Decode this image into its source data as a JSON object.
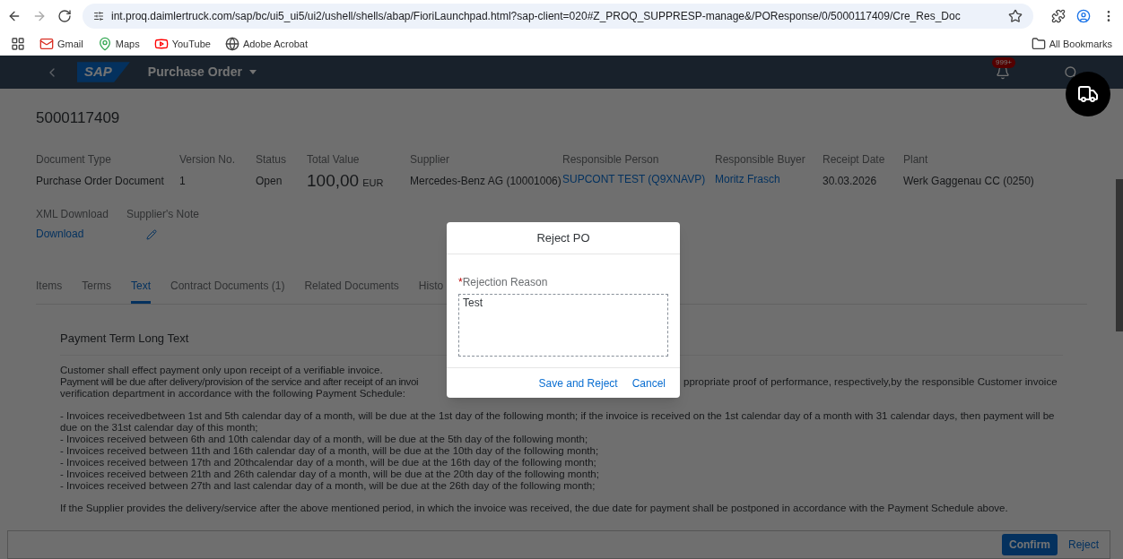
{
  "browser": {
    "url": "int.proq.daimlertruck.com/sap/bc/ui5_ui5/ui2/ushell/shells/abap/FioriLaunchpad.html?sap-client=020#Z_PROQ_SUPPRESP-manage&/POResponse/0/5000117409/Cre_Res_Doc",
    "bookmarks": [
      {
        "label": "Gmail",
        "kind": "gmail"
      },
      {
        "label": "Maps",
        "kind": "maps"
      },
      {
        "label": "YouTube",
        "kind": "youtube"
      },
      {
        "label": "Adobe Acrobat",
        "kind": "globe"
      }
    ],
    "all_bookmarks": "All Bookmarks"
  },
  "shell": {
    "logo": "SAP",
    "title": "Purchase Order",
    "notification_count": "999+"
  },
  "document": {
    "number": "5000117409",
    "fields": [
      {
        "label": "Document Type",
        "value": "Purchase Order Document",
        "kind": "text"
      },
      {
        "label": "Version No.",
        "value": "1",
        "kind": "text"
      },
      {
        "label": "Status",
        "value": "Open",
        "kind": "text"
      },
      {
        "label": "Total Value",
        "value": "100,00",
        "unit": "EUR",
        "kind": "amount"
      },
      {
        "label": "Supplier",
        "value": "Mercedes-Benz AG (10001006)",
        "kind": "text"
      },
      {
        "label": "Responsible Person",
        "value": "SUPCONT TEST (Q9XNAVP)",
        "kind": "link"
      },
      {
        "label": "Responsible Buyer",
        "value": "Moritz Frasch",
        "kind": "link"
      },
      {
        "label": "Receipt Date",
        "value": "30.03.2026",
        "kind": "text"
      },
      {
        "label": "Plant",
        "value": "Werk Gaggenau CC (0250)",
        "kind": "text"
      }
    ],
    "fields_2": [
      {
        "label": "XML Download",
        "value": "Download",
        "kind": "link"
      },
      {
        "label": "Supplier's Note",
        "kind": "edit"
      }
    ]
  },
  "tabs": [
    {
      "label": "Items",
      "selected": false
    },
    {
      "label": "Terms",
      "selected": false
    },
    {
      "label": "Text",
      "selected": true
    },
    {
      "label": "Contract Documents (1)",
      "selected": false
    },
    {
      "label": "Related Documents",
      "selected": false
    },
    {
      "label": "Histo",
      "selected": false
    }
  ],
  "section": {
    "title": "Payment Term Long Text",
    "blocks": [
      [
        [
          "Customer shall effect payment only upon receipt of a verifiable invoice."
        ],
        [
          "Payment will be due after delivery/provision of the service and after receipt of an invoi",
          "ppropriate proof of performance, respectively,by the responsible Customer invoice"
        ],
        [
          "verification department in accordance with the following Payment Schedule:"
        ]
      ],
      [
        [
          "- Invoices receivedbetween 1st and 5th calendar day of a month, will be due at the 1st day of the following month; if the invoice is received on the 1st calendar day of a month with 31 calendar days, then payment will be"
        ],
        [
          "due on the 31st calendar day of this month;"
        ],
        [
          "- Invoices received between 6th and 10th calendar day of a month, will be due at the 5th day of the following month;"
        ],
        [
          "- Invoices received between 11th and 16th calendar day of a month, will be due at the 10th day of the following month;"
        ],
        [
          "- Invoices received between 17th and 20thcalendar day of a month, will be due at the 16th day of the following month;"
        ],
        [
          "- Invoices received between 21th and 26th calendar day of a month, will be due at the 20th day of the following month;"
        ],
        [
          "- Invoices received between 27th and last calendar day of a month, will be due at the 26th day of the following month;"
        ]
      ],
      [
        [
          "If the Supplier provides the delivery/service after the above mentioned period, in which the invoice was received, the due date for payment shall be postponed in accordance with the Payment Schedule above."
        ]
      ]
    ]
  },
  "footer": {
    "buttons": [
      {
        "label": "Confirm",
        "kind": "primary"
      },
      {
        "label": "Reject",
        "kind": "ghost"
      }
    ]
  },
  "dialog": {
    "title": "Reject PO",
    "field": {
      "required_mark": "*",
      "label": "Rejection Reason",
      "value": "Test"
    },
    "buttons": [
      {
        "label": "Save and Reject"
      },
      {
        "label": "Cancel"
      }
    ]
  }
}
